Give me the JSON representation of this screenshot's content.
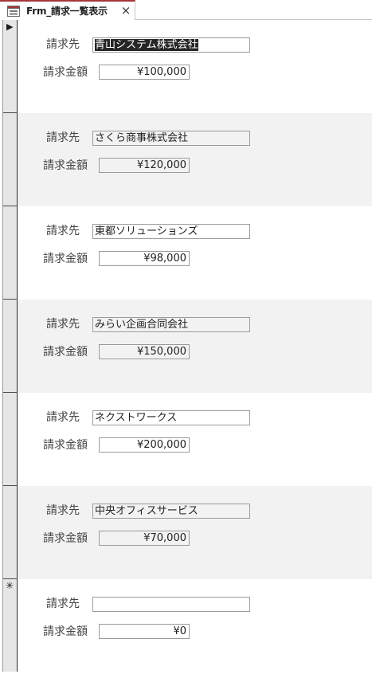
{
  "tab": {
    "title": "Frm_請求一覧表示",
    "close_glyph": "×"
  },
  "labels": {
    "customer": "請求先",
    "amount": "請求金額"
  },
  "selector": {
    "current_glyph": "▶",
    "new_glyph": "✳"
  },
  "records": [
    {
      "customer": "青山システム株式会社",
      "amount": "¥100,000"
    },
    {
      "customer": "さくら商事株式会社",
      "amount": "¥120,000"
    },
    {
      "customer": "東都ソリューションズ",
      "amount": "¥98,000"
    },
    {
      "customer": "みらい企画合同会社",
      "amount": "¥150,000"
    },
    {
      "customer": "ネクストワークス",
      "amount": "¥200,000"
    },
    {
      "customer": "中央オフィスサービス",
      "amount": "¥70,000"
    },
    {
      "customer": "",
      "amount": "¥0"
    }
  ]
}
